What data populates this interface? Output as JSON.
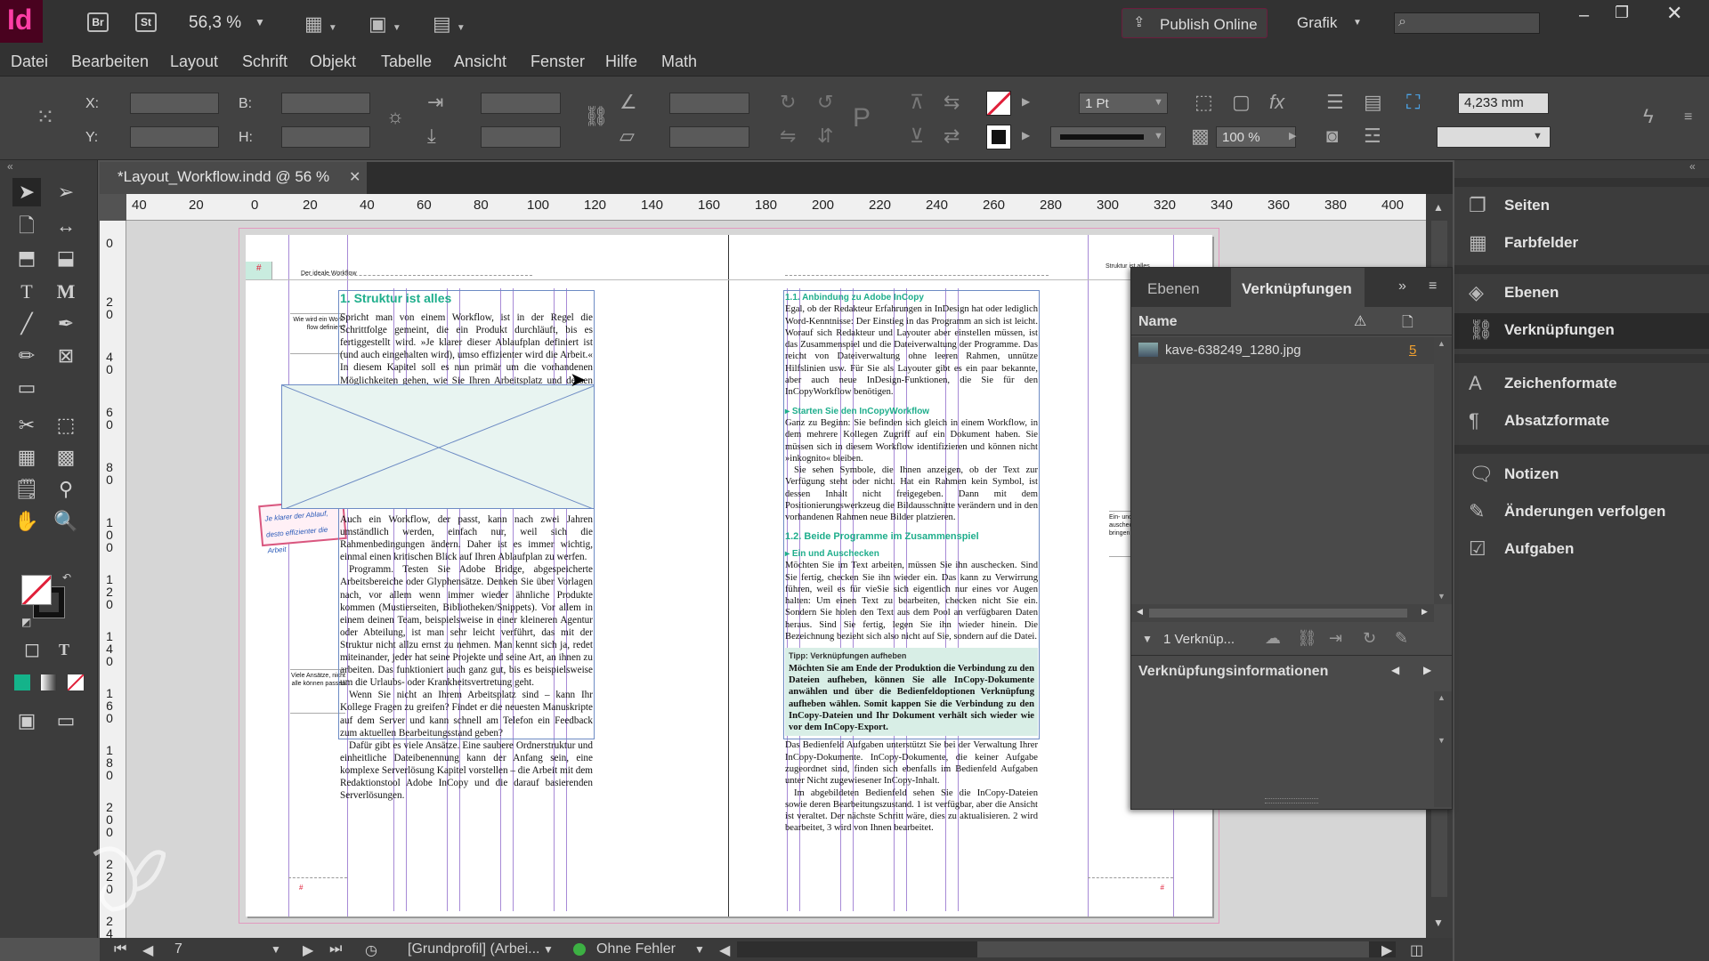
{
  "app": {
    "logo": "Id",
    "bridge_button": "Br",
    "stock_button": "St",
    "zoom": "56,3 %",
    "publish_online": "Publish Online",
    "workspace": "Grafik"
  },
  "menu": [
    "Datei",
    "Bearbeiten",
    "Layout",
    "Schrift",
    "Objekt",
    "Tabelle",
    "Ansicht",
    "Fenster",
    "Hilfe",
    "Math"
  ],
  "control": {
    "x_label": "X:",
    "y_label": "Y:",
    "w_label": "B:",
    "h_label": "H:",
    "stroke_weight": "1 Pt",
    "opacity": "100 %",
    "size_value": "4,233 mm"
  },
  "document": {
    "tab_title": "*Layout_Workflow.indd @ 56 %",
    "ruler_top": [
      "40",
      "20",
      "0",
      "20",
      "40",
      "60",
      "80",
      "100",
      "120",
      "140",
      "160",
      "180",
      "200",
      "220",
      "240",
      "260",
      "280",
      "300",
      "320",
      "340",
      "360",
      "380",
      "400"
    ],
    "ruler_left": [
      "0",
      "2 0",
      "4 0",
      "6 0",
      "8 0",
      "1 0 0",
      "1 2 0",
      "1 4 0",
      "1 6 0",
      "1 8 0",
      "2 0 0",
      "2 2 0",
      "2 4"
    ],
    "header_left": "Der ideale Workflow",
    "header_right": "Struktur ist alles",
    "margin_note_1": "Wie wird ein Work-flow definiert?",
    "margin_note_2": "Viele Ansätze, nicht alle können passen",
    "margin_note_right": "Ein- und auschecken, durch bringen",
    "sticky_note": "Je klarer der Ablauf, desto effizienter die Arbeit",
    "left_heading": "1.  Struktur ist alles",
    "left_para_1": "Spricht man von einem Workflow, ist in der Regel die Schrittfolge gemeint, die ein Produkt durchläuft, bis es fertiggestellt wird. »Je klarer dieser Ablaufplan definiert ist (und auch eingehalten wird), umso effizienter wird die Arbeit.« In diesem Kapitel soll es nun primär um die vorhandenen Möglichkeiten gehen, wie Sie Ihren Arbeitsplatz und dessen Umgebung einrichten können.",
    "left_para_2": "Auch ein Workflow, der passt, kann nach zwei Jahren umständlich werden, einfach nur, weil sich die Rahmenbedingungen ändern. Daher ist es immer wichtig, einmal einen kritischen Blick auf Ihren Ablaufplan zu werfen.",
    "left_para_3": "Programm. Testen Sie Adobe Bridge, abgespeicherte Arbeitsbereiche oder Glyphensätze. Denken Sie über Vorlagen nach, vor allem wenn immer wieder ähnliche Produkte kommen (Mustierseiten, Bibliotheken/Snippets). Vor allem in einem deinen Team, beispielsweise in einer kleineren Agentur oder Abteilung, ist man sehr leicht verführt, das mit der Struktur nicht allzu ernst zu nehmen. Man kennt sich ja, redet miteinander, jeder hat seine Projekte und seine Art, an ihnen zu arbeiten. Das funktioniert auch ganz gut, bis es beispielsweise um die Urlaubs- oder Krankheitsvertretung geht.",
    "left_para_4": "Wenn Sie nicht an Ihrem Arbeitsplatz sind – kann Ihr Kollege Fragen zu greifen? Findet er die neuesten Manuskripte auf dem Server und kann schnell am Telefon ein Feedback zum aktuellen Bearbeitungsstand geben?",
    "left_para_5": "Dafür gibt es viele Ansätze. Eine saubere Ordnerstruktur und einheitliche Dateibenennung kann der Anfang sein, eine komplexe Serverlösung Kapitel vorstellen – die Arbeit mit dem Redaktionstool Adobe InCopy und die darauf basierenden Serverlösungen.",
    "right_h_1": "1.1.  Anbindung zu Adobe InCopy",
    "right_para_1": "Egal, ob der Redakteur Erfahrungen in InDesign hat oder lediglich Word-Kenntnisse: Der Einstieg in das Programm an sich ist leicht. Worauf sich Redakteur und Layouter aber einstellen müssen, ist das Zusammenspiel und die Dateiverwaltung der Programme. Das reicht von Dateiverwaltung ohne leeren Rahmen, unnütze Hilfslinien usw. Für Sie als Layouter gibt es ein paar bekannte, aber auch neue InDesign-Funktionen, die Sie für den InCopyWorkflow benötigen.",
    "right_h_2": "Starten Sie den InCopyWorkflow",
    "right_para_2": "Ganz zu Beginn: Sie befinden sich gleich in einem Workflow, in dem mehrere Kollegen Zugriff auf ein Dokument haben. Sie müssen sich in diesem Workflow identifizieren und können nicht »inkognito« bleiben.",
    "right_para_3": "Sie sehen Symbole, die Ihnen anzeigen, ob der Text zur Verfügung steht oder nicht. Hat ein Rahmen kein Symbol, ist dessen Inhalt nicht freigegeben. Dann mit dem Positionierungswerkzeug die Bildausschnitte verändern und in den vorhandenen Rahmen neue Bilder platzieren.",
    "right_h_3": "1.2.  Beide Programme im Zusammenspiel",
    "right_h_4": "Ein und Auschecken",
    "right_para_4": "Möchten Sie im Text arbeiten, müssen Sie ihn auschecken. Sind Sie fertig, checken Sie ihn wieder ein. Das kann zu Verwirrung führen, weil es für vieSie sich eigentlich nur eines vor Augen halten: Um einen Text zu bearbeiten, checken nicht Sie ein. Sondern Sie holen den Text aus dem Pool an verfügbaren Daten heraus. Sind Sie fertig, legen Sie ihn wieder hinein. Die Bezeichnung bezieht sich also nicht auf Sie, sondern auf die Datei.",
    "tip_heading": "Tipp: Verknüpfungen aufheben",
    "tip_text": "Möchten Sie am Ende der Produktion die Verbindung zu den Dateien aufheben, können Sie alle InCopy-Dokumente anwählen und über die Bedienfeldoptionen Verknüpfung aufheben wählen. Somit kappen Sie die Verbindung zu den InCopy-Dateien und Ihr Dokument verhält sich wieder wie vor dem InCopy-Export.",
    "right_para_5": "Das Bedienfeld Aufgaben unterstützt Sie bei der Verwaltung Ihrer InCopy-Dokumente. InCopy-Dokumente, die keiner Aufgabe zugeordnet sind, finden sich ebenfalls im Bedienfeld Aufgaben unter Nicht zugewiesener InCopy-Inhalt.",
    "right_para_6": "Im abgebildeten Bedienfeld sehen Sie die InCopy-Dateien sowie deren Bearbeitungszustand. 1 ist verfügbar, aber die Ansicht ist veraltet. Der nächste Schritt wäre, dies zu aktualisieren. 2 wird bearbeitet, 3 wird von Ihnen bearbeitet."
  },
  "status": {
    "page_number": "7",
    "profile": "[Grundprofil] (Arbei...",
    "preflight": "Ohne Fehler",
    "preflight_color": "#3cb043"
  },
  "links_panel": {
    "tab_layers": "Ebenen",
    "tab_links": "Verknüpfungen",
    "col_name": "Name",
    "link_file": "kave-638249_1280.jpg",
    "link_page": "5",
    "footer_count": "1 Verknüp...",
    "info_title": "Verknüpfungsinformationen"
  },
  "right_panel": {
    "items": [
      {
        "label": "Seiten",
        "icon": "pages-icon"
      },
      {
        "label": "Farbfelder",
        "icon": "swatches-icon"
      },
      {
        "label": "Ebenen",
        "icon": "layers-icon"
      },
      {
        "label": "Verknüpfungen",
        "icon": "links-icon"
      },
      {
        "label": "Zeichenformate",
        "icon": "character-styles-icon"
      },
      {
        "label": "Absatzformate",
        "icon": "paragraph-styles-icon"
      },
      {
        "label": "Notizen",
        "icon": "notes-icon"
      },
      {
        "label": "Änderungen verfolgen",
        "icon": "track-changes-icon"
      },
      {
        "label": "Aufgaben",
        "icon": "assignments-icon"
      }
    ]
  },
  "colors": {
    "accent_pink": "#ff3ea5",
    "heading_teal": "#1fae8c",
    "app_bg": "#535353"
  }
}
